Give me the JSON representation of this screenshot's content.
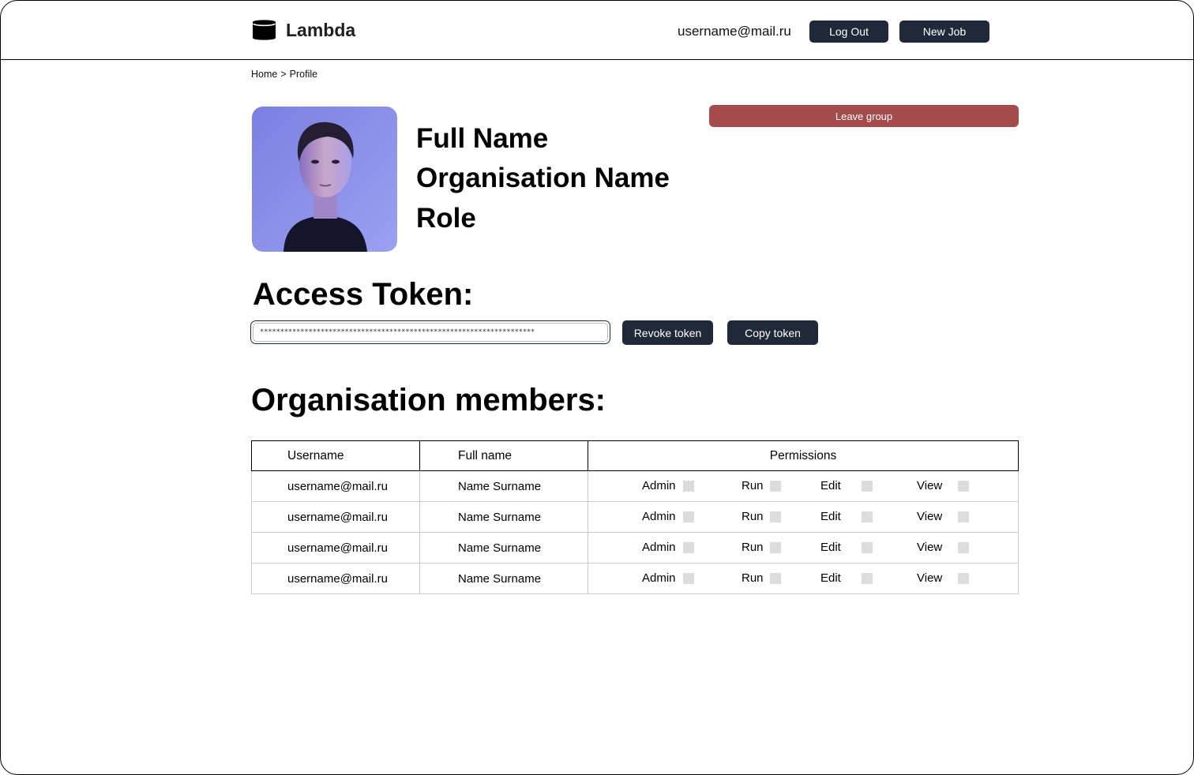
{
  "header": {
    "logo_text": "Lambda",
    "logo_icon": "database-cylinder-icon",
    "user_email": "username@mail.ru",
    "logout_label": "Log Out",
    "new_job_label": "New Job"
  },
  "breadcrumb": {
    "home": "Home",
    "separator": ">",
    "current": "Profile"
  },
  "profile": {
    "full_name": "Full Name",
    "organisation": "Organisation Name",
    "role": "Role",
    "leave_group_label": "Leave group"
  },
  "token": {
    "title": "Access Token:",
    "value": "********************************************************************",
    "revoke_label": "Revoke token",
    "copy_label": "Copy token"
  },
  "members": {
    "title": "Organisation members:",
    "columns": [
      "Username",
      "Full name",
      "Permissions"
    ],
    "permission_labels": [
      "Admin",
      "Run",
      "Edit",
      "View"
    ],
    "rows": [
      {
        "username": "username@mail.ru",
        "full_name": "Name Surname"
      },
      {
        "username": "username@mail.ru",
        "full_name": "Name Surname"
      },
      {
        "username": "username@mail.ru",
        "full_name": "Name Surname"
      },
      {
        "username": "username@mail.ru",
        "full_name": "Name Surname"
      }
    ]
  },
  "colors": {
    "dark_button": "#1f2937",
    "leave_button": "#a54b4c",
    "checkbox": "#dcdcdc"
  }
}
